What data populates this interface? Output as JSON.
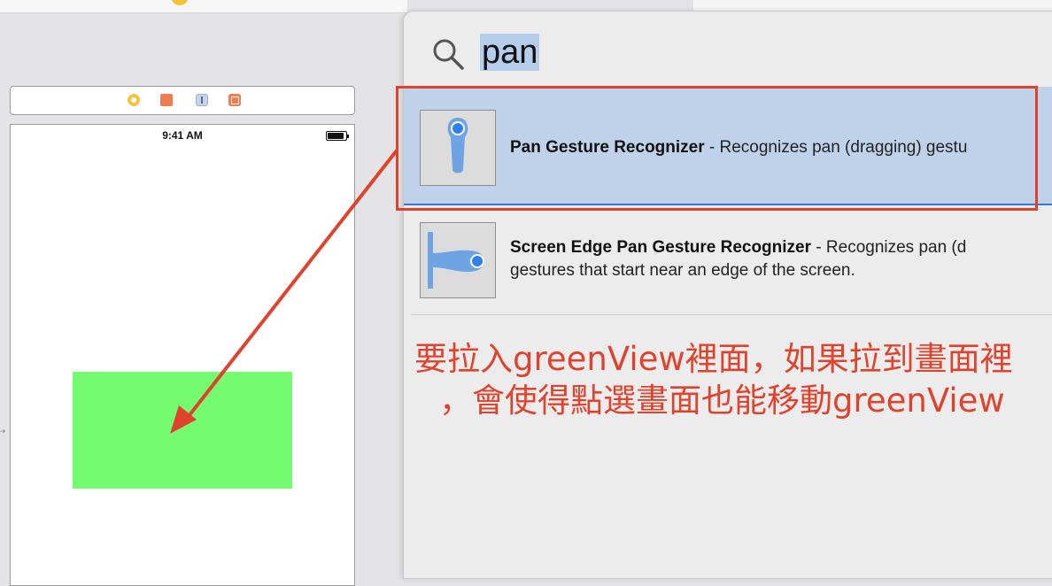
{
  "search": {
    "query": "pan"
  },
  "canvas": {
    "status_time": "9:41 AM"
  },
  "results": [
    {
      "title": "Pan Gesture Recognizer",
      "description": " - Recognizes pan (dragging) gestu"
    },
    {
      "title": "Screen Edge Pan Gesture Recognizer",
      "description": " - Recognizes pan (d",
      "description_line2": "gestures that start near an edge of the screen."
    }
  ],
  "annotation": {
    "line1": "要拉入greenView裡面，如果拉到畫面裡",
    "line2": "，會使得點選畫面也能移動greenView",
    "color": "#e0432d"
  },
  "colors": {
    "green_view": "#75fb6f",
    "selection": "#c0d2ea",
    "accent": "#3a77d6"
  }
}
